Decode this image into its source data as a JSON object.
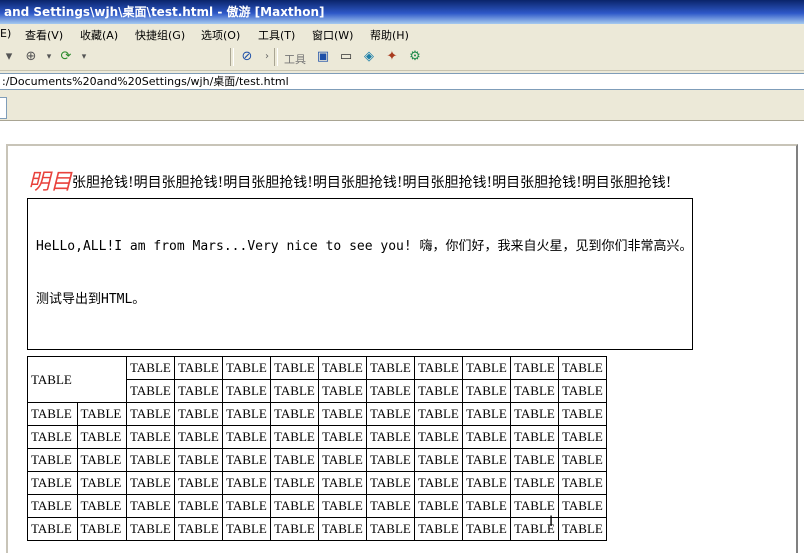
{
  "window": {
    "title": "and Settings\\wjh\\桌面\\test.html - 傲游 [Maxthon]"
  },
  "menu": {
    "items": [
      "E)",
      "查看(V)",
      "收藏(A)",
      "快捷组(G)",
      "选项(O)",
      "工具(T)",
      "窗口(W)",
      "帮助(H)"
    ]
  },
  "toolbar": {
    "tools_label": "工具",
    "icons": [
      "forward-icon",
      "refresh-icon",
      "safari-icon",
      "monitor-icon",
      "window-icon",
      "cube-icon",
      "puzzle-icon",
      "gear-tool-icon"
    ]
  },
  "address": {
    "url": ":/Documents%20and%20Settings/wjh/桌面/test.html"
  },
  "page": {
    "marquee_lead": "明目",
    "marquee_text": "张胆抢钱!明目张胆抢钱!明目张胆抢钱!明目张胆抢钱!明目张胆抢钱!明目张胆抢钱!明目张胆抢钱!",
    "box_line1": "HeLLo,ALL!I am from Mars...Very nice to see you! 嗨，你们好，我来自火星，见到你们非常高兴。",
    "box_line2": "测试导出到HTML。",
    "table": {
      "span_cell": "TABLE",
      "cell": "TABLE",
      "top_rows_cells": 10,
      "full_rows": 6,
      "full_row_cells": 12
    }
  }
}
